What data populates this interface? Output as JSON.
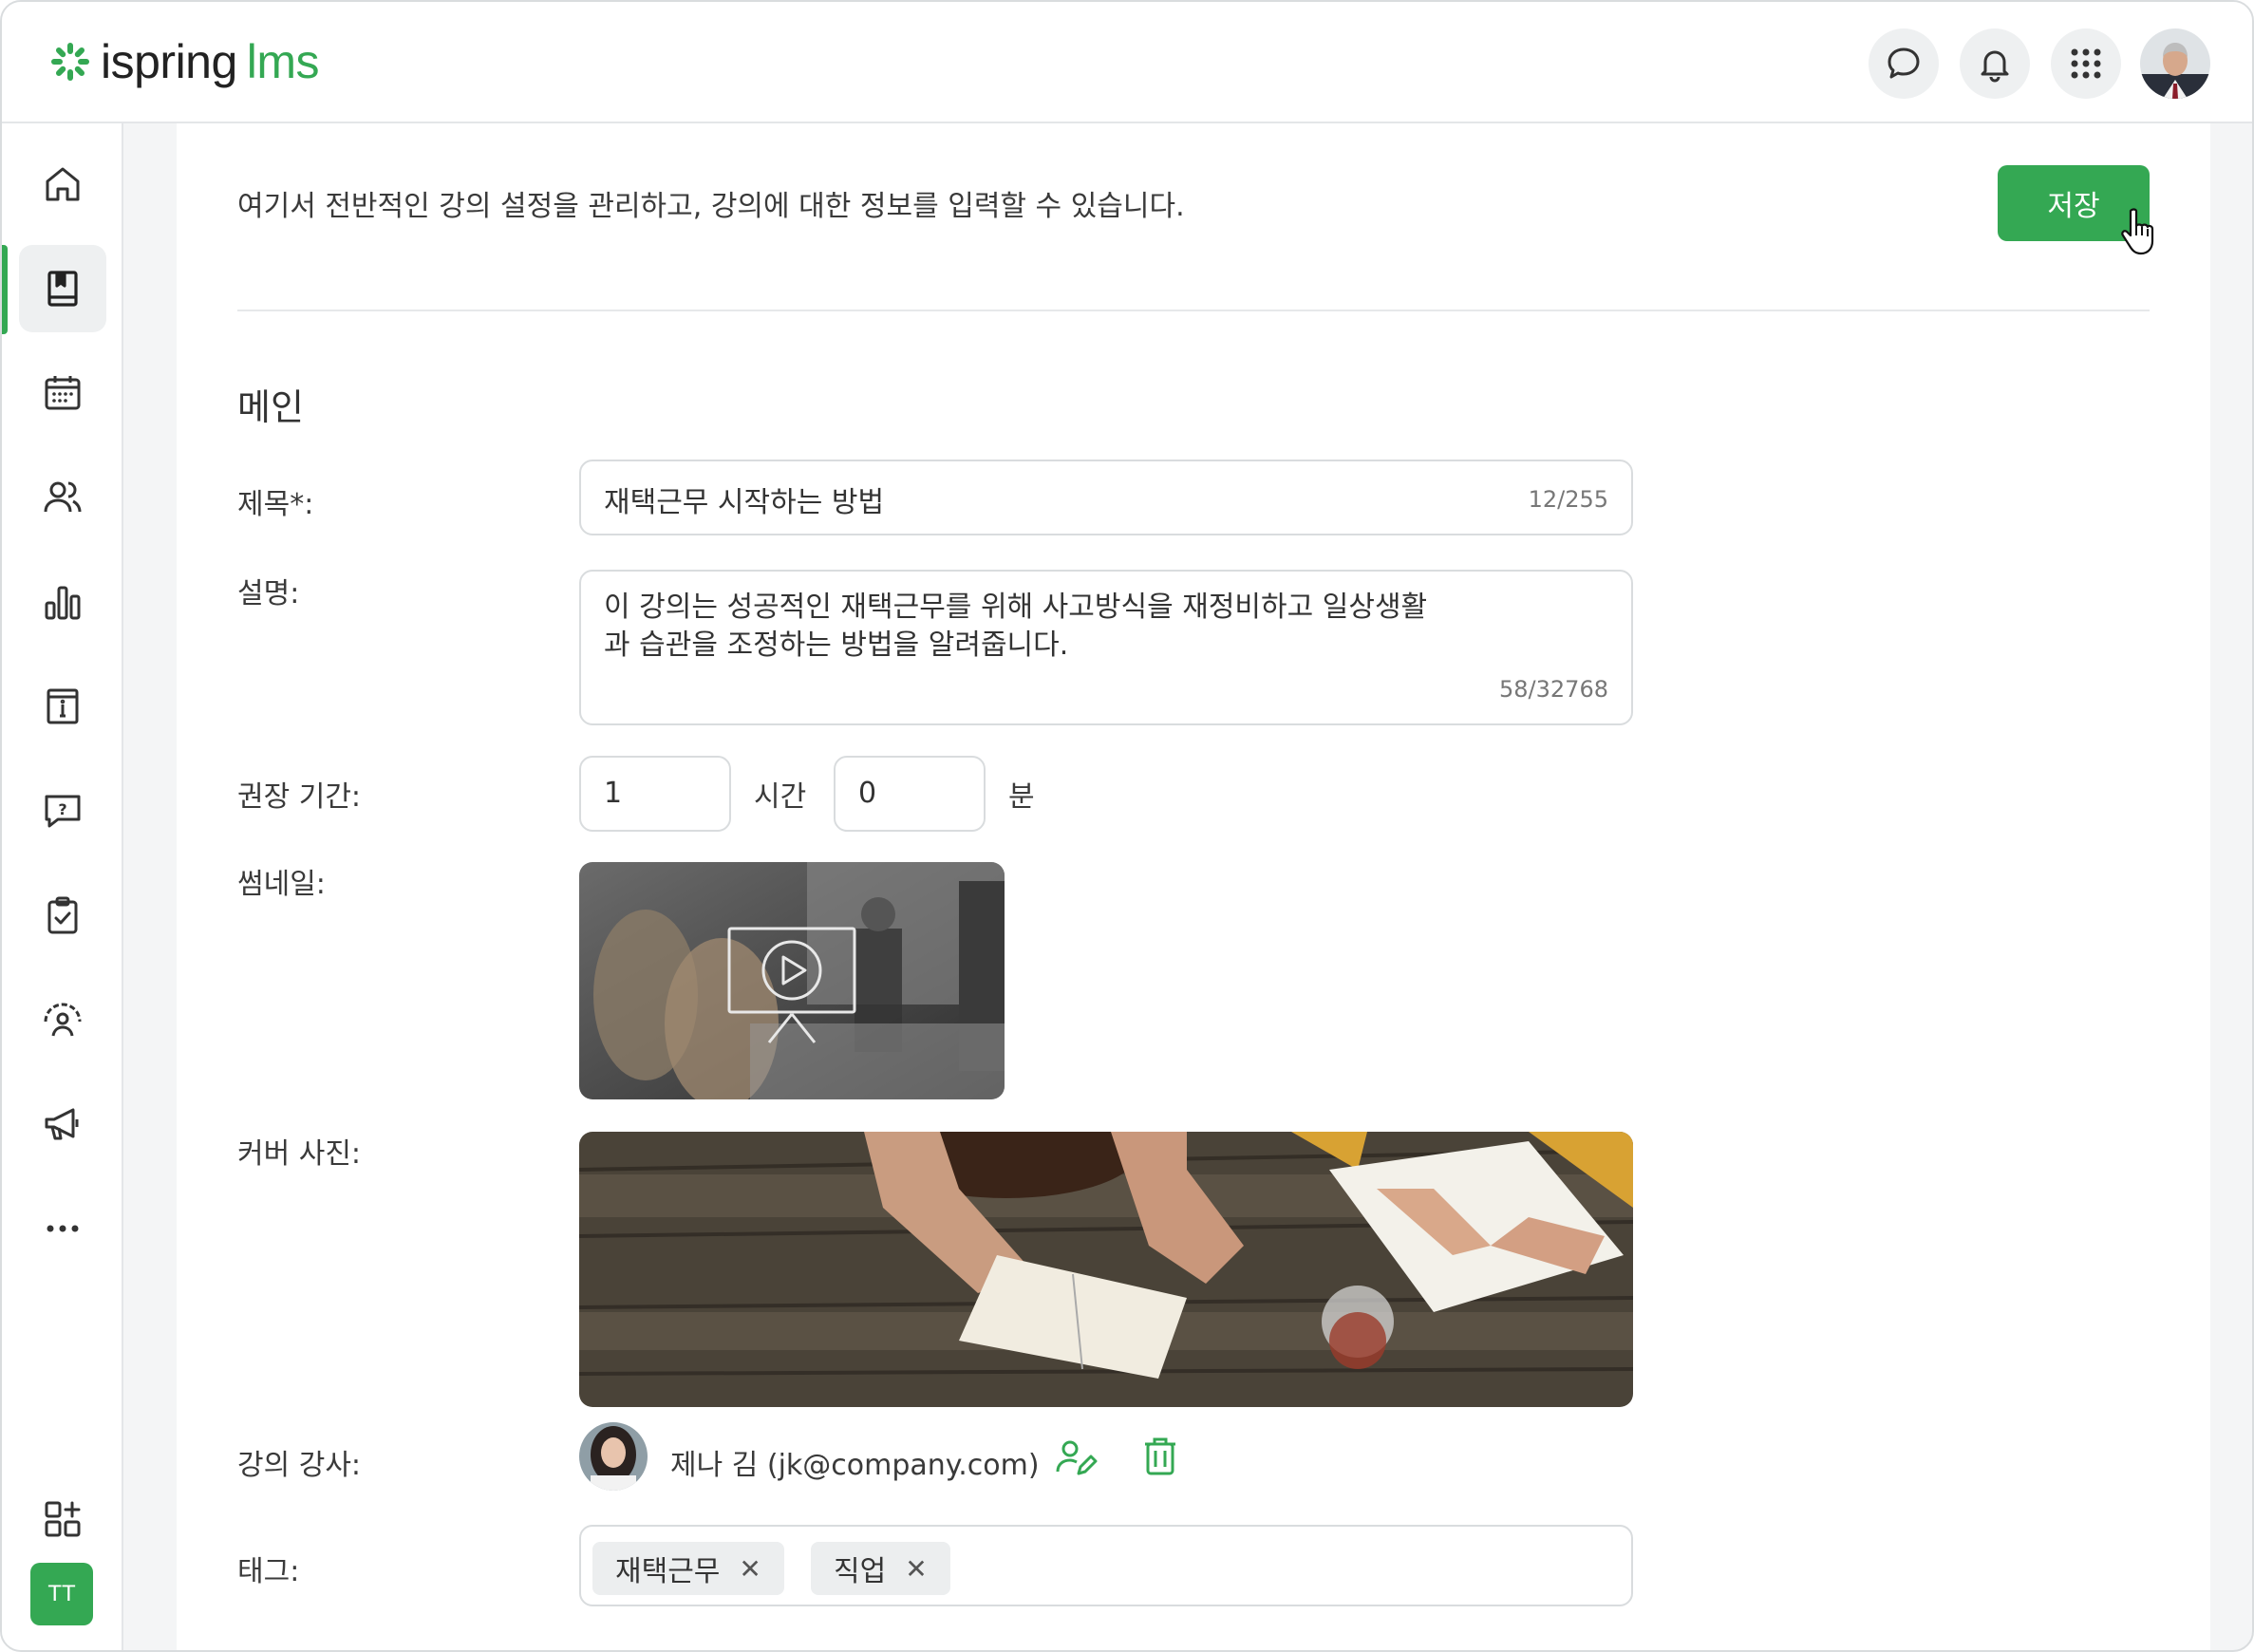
{
  "header": {
    "logo_main": "ispring",
    "logo_accent": "lms",
    "icons": [
      "chat-icon",
      "bell-icon",
      "apps-grid-icon"
    ],
    "accent_color": "#34a853"
  },
  "sidebar": {
    "items": [
      {
        "icon": "home-icon"
      },
      {
        "icon": "book-icon",
        "active": true
      },
      {
        "icon": "calendar-icon"
      },
      {
        "icon": "users-icon"
      },
      {
        "icon": "bar-chart-icon"
      },
      {
        "icon": "info-doc-icon"
      },
      {
        "icon": "question-bubble-icon"
      },
      {
        "icon": "clipboard-check-icon"
      },
      {
        "icon": "speedometer-user-icon"
      },
      {
        "icon": "megaphone-icon"
      },
      {
        "icon": "more-dots-icon"
      }
    ],
    "bottom_icon": "add-widget-icon",
    "user_initials": "TT"
  },
  "page": {
    "intro": "여기서 전반적인 강의 설정을 관리하고, 강의에 대한 정보를 입력할 수 있습니다.",
    "save_label": "저장",
    "section_title": "메인"
  },
  "form": {
    "title": {
      "label": "제목*:",
      "value": "재택근무 시작하는 방법",
      "counter": "12/255"
    },
    "description": {
      "label": "설명:",
      "line1": "이 강의는 성공적인 재택근무를 위해 사고방식을 재정비하고 일상생활",
      "line2": "과 습관을 조정하는 방법을 알려줍니다.",
      "counter": "58/32768"
    },
    "duration": {
      "label": "권장 기간:",
      "hours": "1",
      "hours_unit": "시간",
      "minutes": "0",
      "minutes_unit": "분"
    },
    "thumbnail": {
      "label": "썸네일:"
    },
    "cover": {
      "label": "커버 사진:"
    },
    "instructor": {
      "label": "강의 강사:",
      "name": "제나 김 (jk@company.com)"
    },
    "tags": {
      "label": "태그:",
      "items": [
        "재택근무",
        "직업"
      ]
    }
  }
}
